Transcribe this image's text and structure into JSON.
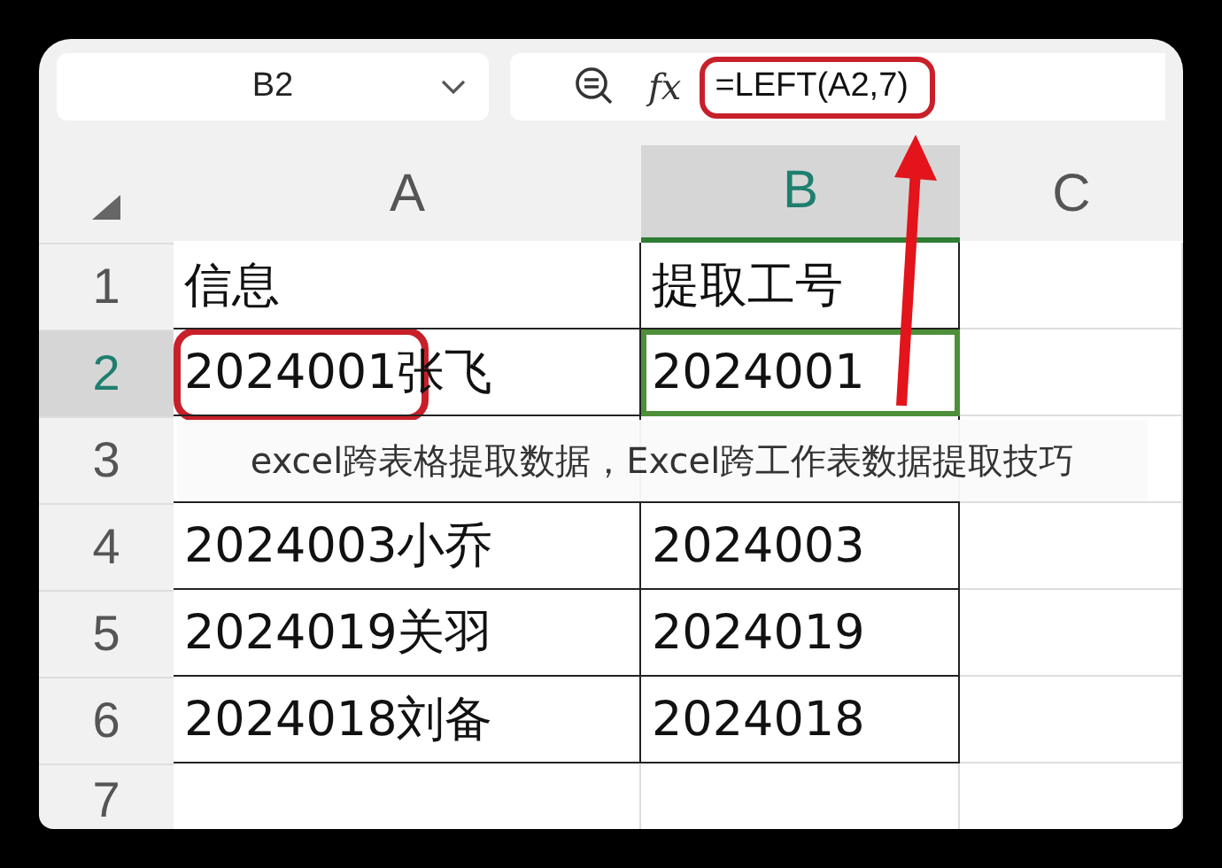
{
  "name_box": {
    "value": "B2"
  },
  "formula_bar": {
    "function_label": "fx",
    "value": "=LEFT(A2,7)"
  },
  "columns": [
    {
      "label": "A",
      "selected": false
    },
    {
      "label": "B",
      "selected": true
    },
    {
      "label": "C",
      "selected": false
    }
  ],
  "rows": [
    {
      "number": "1",
      "selected": false,
      "cells": [
        "信息",
        "提取工号",
        ""
      ]
    },
    {
      "number": "2",
      "selected": true,
      "cells": [
        "2024001张飞",
        "2024001",
        ""
      ]
    },
    {
      "number": "3",
      "selected": false,
      "cells": [
        "",
        "",
        ""
      ]
    },
    {
      "number": "4",
      "selected": false,
      "cells": [
        "2024003小乔",
        "2024003",
        ""
      ]
    },
    {
      "number": "5",
      "selected": false,
      "cells": [
        "2024019关羽",
        "2024019",
        ""
      ]
    },
    {
      "number": "6",
      "selected": false,
      "cells": [
        "2024018刘备",
        "2024018",
        ""
      ]
    },
    {
      "number": "7",
      "selected": false,
      "cells": [
        "",
        "",
        ""
      ]
    }
  ],
  "caption": "excel跨表格提取数据，Excel跨工作表数据提取技巧"
}
